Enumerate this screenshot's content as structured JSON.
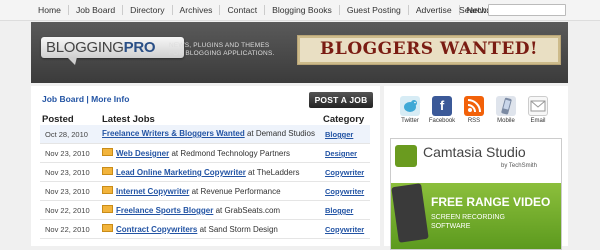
{
  "topnav": {
    "links": [
      "Home",
      "Job Board",
      "Directory",
      "Archives",
      "Contact",
      "Blogging Books",
      "Guest Posting",
      "Advertise",
      "Network"
    ],
    "search_label": "Search:",
    "search_value": ""
  },
  "header": {
    "logo_part1": "BLOGGING",
    "logo_part2": "PRO",
    "tagline_line1": "NEWS, PLUGINS AND THEMES",
    "tagline_line2": "FOR BLOGGING APPLICATIONS.",
    "banner_text": "BLOGGERS WANTED!"
  },
  "jobs": {
    "breadcrumb_board": "Job Board",
    "breadcrumb_sep": " | ",
    "breadcrumb_info": "More Info",
    "post_button": "POST A JOB",
    "col_posted": "Posted",
    "col_latest": "Latest Jobs",
    "col_category": "Category",
    "rows": [
      {
        "date": "Oct 28, 2010",
        "title": "Freelance Writers & Bloggers Wanted",
        "at": "at Demand Studios",
        "category": "Blogger",
        "featured": false
      },
      {
        "date": "Nov 23, 2010",
        "title": "Web Designer",
        "at": "at Redmond Technology Partners",
        "category": "Designer",
        "featured": true
      },
      {
        "date": "Nov 23, 2010",
        "title": "Lead Online Marketing Copywriter",
        "at": "at TheLadders",
        "category": "Copywriter",
        "featured": true
      },
      {
        "date": "Nov 23, 2010",
        "title": "Internet Copywriter",
        "at": "at Revenue Performance",
        "category": "Copywriter",
        "featured": true
      },
      {
        "date": "Nov 22, 2010",
        "title": "Freelance Sports Blogger",
        "at": "at GrabSeats.com",
        "category": "Blogger",
        "featured": true
      },
      {
        "date": "Nov 22, 2010",
        "title": "Contract Copywriters",
        "at": "at Sand Storm Design",
        "category": "Copywriter",
        "featured": true
      }
    ]
  },
  "social": [
    {
      "label": "Twitter",
      "icon": "twitter-icon"
    },
    {
      "label": "Facebook",
      "icon": "facebook-icon"
    },
    {
      "label": "RSS",
      "icon": "rss-icon"
    },
    {
      "label": "Mobile",
      "icon": "mobile-icon"
    },
    {
      "label": "Email",
      "icon": "email-icon"
    }
  ],
  "ad": {
    "product": "Camtasia Studio",
    "byline": "by TechSmith",
    "headline": "FREE RANGE VIDEO",
    "sub1": "SCREEN RECORDING",
    "sub2": "SOFTWARE"
  }
}
